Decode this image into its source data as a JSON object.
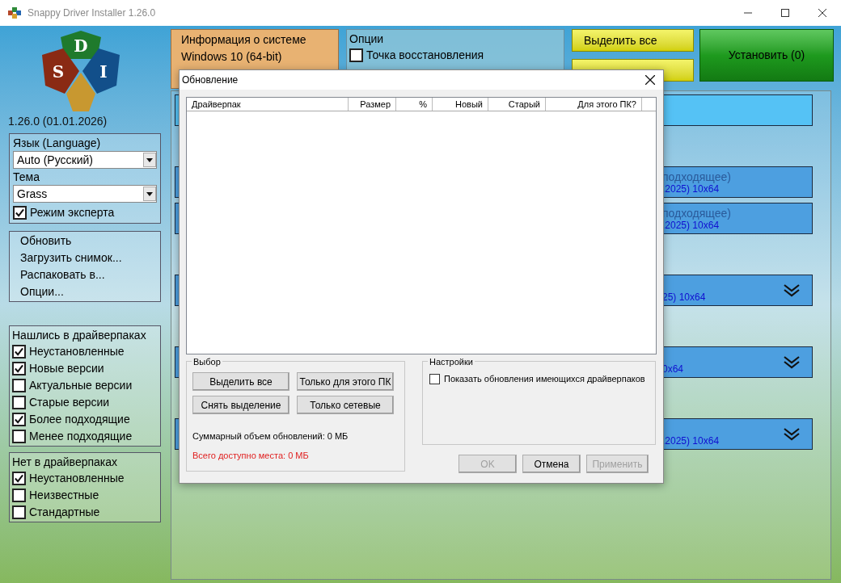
{
  "window": {
    "title": "Snappy Driver Installer 1.26.0"
  },
  "logo": {
    "letters": [
      "D",
      "S",
      "I"
    ]
  },
  "version": "1.26.0 (01.01.2026)",
  "settings": {
    "language_label": "Язык (Language)",
    "language_value": "Auto (Русский)",
    "theme_label": "Тема",
    "theme_value": "Grass",
    "expert": {
      "label": "Режим эксперта",
      "checked": true
    }
  },
  "actions": [
    "Обновить",
    "Загрузить снимок...",
    "Распаковать в...",
    "Опции..."
  ],
  "filters": [
    {
      "title": "Нашлись в драйверпаках",
      "items": [
        {
          "label": "Неустановленные",
          "checked": true
        },
        {
          "label": "Новые версии",
          "checked": true
        },
        {
          "label": "Актуальные версии",
          "checked": false
        },
        {
          "label": "Старые версии",
          "checked": false
        },
        {
          "label": "Более подходящие",
          "checked": true
        },
        {
          "label": "Менее подходящие",
          "checked": false
        }
      ]
    },
    {
      "title": "Нет в драйверпаках",
      "items": [
        {
          "label": "Неустановленные",
          "checked": true
        },
        {
          "label": "Неизвестные",
          "checked": false
        },
        {
          "label": "Стандартные",
          "checked": false
        }
      ]
    }
  ],
  "system_info": {
    "title": "Информация о системе",
    "os": "Windows 10 (64-bit)"
  },
  "options": {
    "title": "Опции",
    "items": [
      {
        "label": "Точка восстановления",
        "checked": false
      }
    ]
  },
  "select_all_button": "Выделить все",
  "install_button": "Установить (0)",
  "driver_cards": [
    {
      "kind": "header",
      "expandable": false
    },
    {
      "kind": "driver",
      "line1": "подходящее)",
      "line2": ".2025) 10x64",
      "expandable": false
    },
    {
      "kind": "driver",
      "line1": "подходящее)",
      "line2": ".2025) 10x64",
      "expandable": false
    },
    {
      "kind": "driver",
      "line2": "25) 10x64",
      "expandable": true
    },
    {
      "kind": "driver",
      "line2": "0x64",
      "expandable": true
    },
    {
      "kind": "driver",
      "line2": ".2025) 10x64",
      "expandable": true
    }
  ],
  "dialog": {
    "title": "Обновление",
    "columns": [
      "Драйверпак",
      "Размер",
      "%",
      "Новый",
      "Старый",
      "Для этого ПК?"
    ],
    "selection": {
      "title": "Выбор",
      "buttons": [
        "Выделить все",
        "Только для этого ПК",
        "Снять выделение",
        "Только сетевые"
      ],
      "total": "Суммарный объем обновлений: 0 МБ",
      "free_space": {
        "text": "Всего доступно места: 0 МБ",
        "warning": true
      }
    },
    "settings": {
      "title": "Настройки",
      "show_existing": {
        "label": "Показать обновления имеющихся драйверпаков",
        "checked": false
      }
    },
    "buttons": [
      {
        "label": "OK",
        "disabled": true
      },
      {
        "label": "Отмена",
        "disabled": false
      },
      {
        "label": "Применить",
        "disabled": true
      }
    ]
  }
}
